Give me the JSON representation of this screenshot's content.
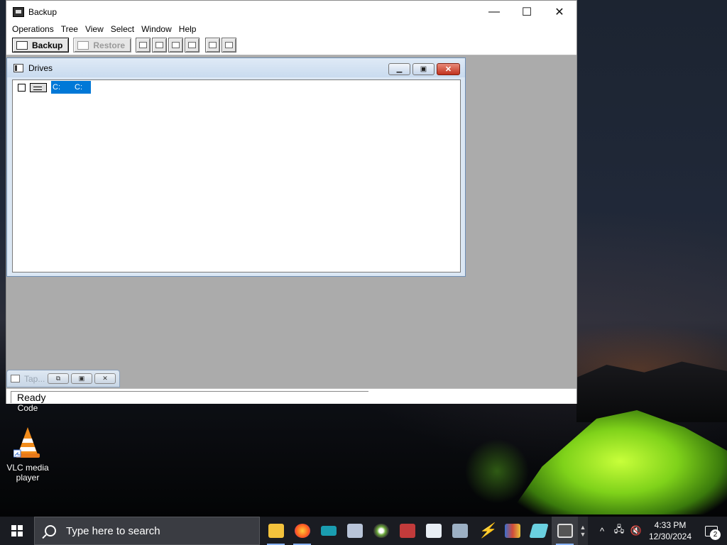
{
  "window": {
    "title": "Backup",
    "controls": {
      "minimize": "—",
      "maximize": "☐",
      "close": "✕"
    }
  },
  "menu": [
    "Operations",
    "Tree",
    "View",
    "Select",
    "Window",
    "Help"
  ],
  "toolbar": {
    "backup_label": "Backup",
    "restore_label": "Restore"
  },
  "drives_window": {
    "title": "Drives",
    "drive": {
      "label": "C:",
      "volume": "C:"
    }
  },
  "tape_window": {
    "title": "Tap..."
  },
  "status": {
    "text": "Ready"
  },
  "desktop_icons": {
    "vscode_label": "Code",
    "vlc_label": "VLC media player"
  },
  "taskbar": {
    "search_placeholder": "Type here to search",
    "time": "4:33 PM",
    "date": "12/30/2024",
    "notification_count": "2"
  },
  "colors": {
    "selection": "#0078d7",
    "mdi_background": "#ababab",
    "taskbar": "#1a1c22"
  }
}
